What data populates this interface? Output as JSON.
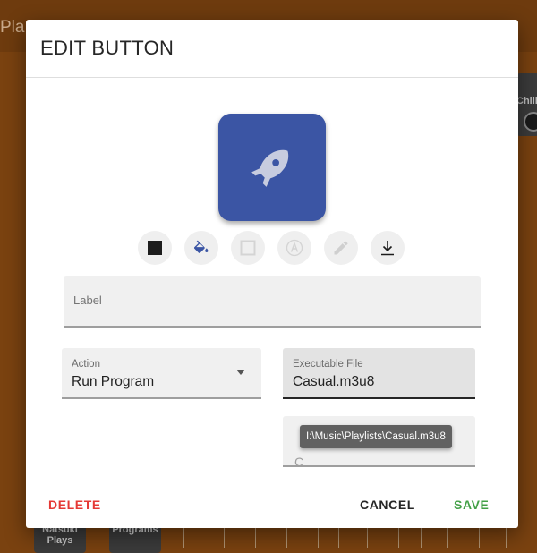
{
  "background": {
    "title_fragment": "Pla",
    "tile_right_text": "Chill",
    "tiles": [
      {
        "line1": "Natsuki",
        "line2": "Plays"
      },
      {
        "line1": "Programs",
        "line2": ""
      }
    ]
  },
  "dialog": {
    "title": "EDIT BUTTON",
    "icon": {
      "name": "rocket-icon",
      "background_color": "#3b55a4",
      "foreground_color": "#c7ccdf"
    },
    "tools": [
      {
        "name": "background-color-swatch-icon"
      },
      {
        "name": "paint-bucket-icon"
      },
      {
        "name": "border-square-icon"
      },
      {
        "name": "text-style-icon"
      },
      {
        "name": "pencil-icon"
      },
      {
        "name": "download-icon"
      }
    ],
    "label_field": {
      "placeholder": "Label",
      "value": ""
    },
    "action_field": {
      "label": "Action",
      "value": "Run Program"
    },
    "executable_field": {
      "label": "Executable File",
      "value": "Casual.m3u8"
    },
    "partial_field_text": "C",
    "tooltip": "I:\\Music\\Playlists\\Casual.m3u8",
    "buttons": {
      "delete": "DELETE",
      "cancel": "CANCEL",
      "save": "SAVE"
    },
    "colors": {
      "danger": "#e53935",
      "success": "#43a047",
      "accent": "#3b55a4"
    }
  }
}
